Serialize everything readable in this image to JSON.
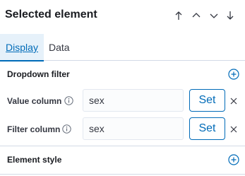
{
  "header": {
    "title": "Selected element",
    "nav_icons": [
      "arrow-up-icon",
      "chevron-up-icon",
      "chevron-down-icon",
      "arrow-down-icon"
    ]
  },
  "tabs": [
    {
      "label": "Display",
      "selected": true
    },
    {
      "label": "Data",
      "selected": false
    }
  ],
  "dropdown_filter": {
    "title": "Dropdown filter",
    "fields": [
      {
        "label": "Value column",
        "value": "sex",
        "button": "Set"
      },
      {
        "label": "Filter column",
        "value": "sex",
        "button": "Set"
      }
    ]
  },
  "element_style": {
    "title": "Element style"
  },
  "colors": {
    "accent": "#006bb8",
    "text": "#1a1c21",
    "border": "#d3dae6",
    "selected_tab_bg": "#e6f1fa"
  }
}
